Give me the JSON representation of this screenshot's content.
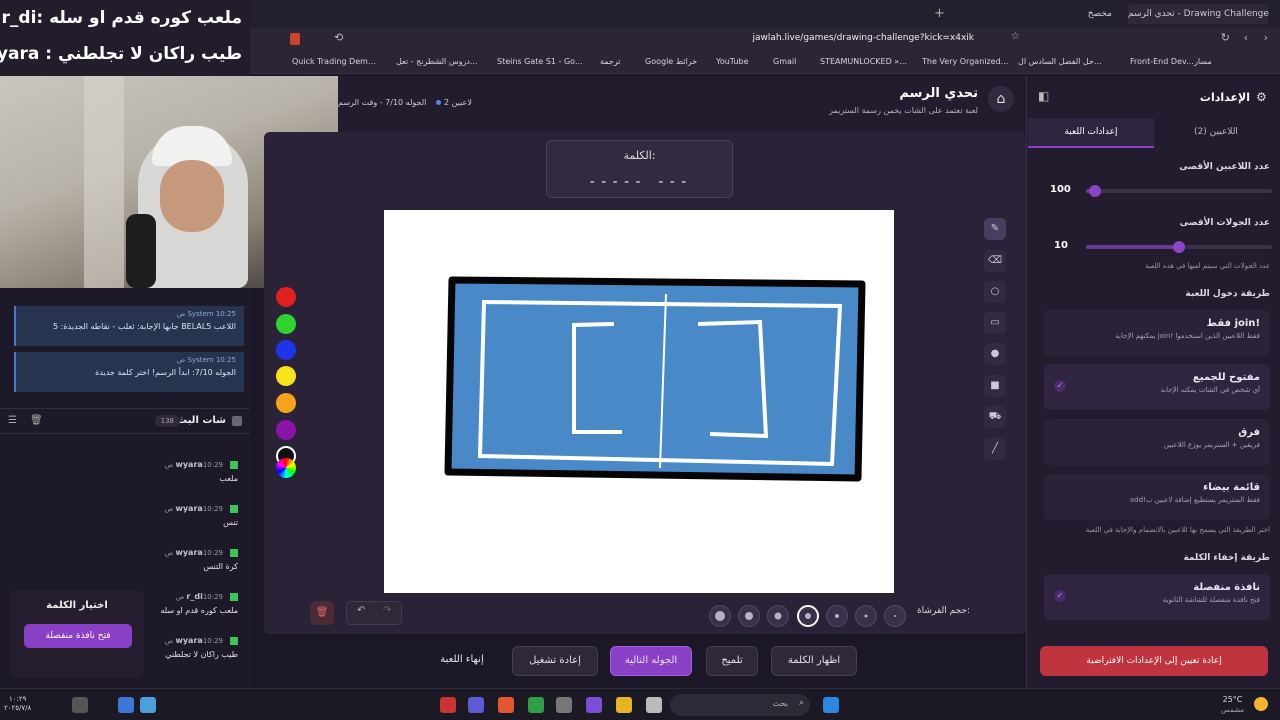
{
  "overlay": {
    "line1": "ملعب كوره قدم او سله :r_di",
    "line2": "طيب راكان لا تجلطني : wyara"
  },
  "browser": {
    "tab_title": "تحدي الرسم - Drawing Challenge",
    "tab2": "مخصخ",
    "url": "jawlah.live/games/drawing-challenge?kick=x4xik",
    "bookmarks": [
      "Quick Trading Dem...",
      "دروس الشطرنج - تعل...",
      "Steins Gate S1 - Go...",
      "ترجمة",
      "Google خرائط",
      "YouTube",
      "Gmail",
      "STEAMUNLOCKED »...",
      "The Very Organized...",
      "حل الفصل السادس ال...",
      "Front-End Dev...",
      "مسار"
    ]
  },
  "header": {
    "title": "تحدي الرسم",
    "subtitle": "لعبة تعتمد على الشات يخمن رسمة الستريمر",
    "players": "2 لاعبين",
    "round_info": "الجوله 7/10 - وقت الرسم"
  },
  "word": {
    "label": "الكلمة:",
    "mask": "----- ---"
  },
  "palette": {
    "colors": [
      "#e0201e",
      "#2fd22f",
      "#1c35e8",
      "#f8e21c",
      "#f5a41a",
      "#8a13a8",
      "#111111"
    ]
  },
  "tools": [
    "pencil-icon",
    "eraser-icon",
    "circle-icon",
    "rect-icon",
    "fill-circle-icon",
    "fill-rect-icon",
    "bucket-icon",
    "line-icon"
  ],
  "brush": {
    "label": "حجم الفرشاة:",
    "sizes": [
      1,
      2,
      3,
      5,
      7,
      9,
      11
    ],
    "selected_index": 3
  },
  "actions": {
    "show_word": "اظهار الكلمة",
    "hint": "تلميح",
    "next_round": "الجوله التالية",
    "restart": "إعادة تشغيل",
    "end_game": "إنهاء اللعبة"
  },
  "chat": {
    "title": "شات البث",
    "count": "138",
    "system_messages": [
      {
        "meta": "System 10:25 ص",
        "text": "اللاعب BELAL5 جابها الإجابة: ثعلب - نقاطه الجديدة: 5"
      },
      {
        "meta": "System 10:25 ص",
        "text": "الجوله 7/10: ابدأ الرسم! اختر كلمة جديدة"
      }
    ],
    "messages": [
      {
        "user": "wyara",
        "time": "10:29 ص",
        "text": "ملعب"
      },
      {
        "user": "wyara",
        "time": "10:29 ص",
        "text": "تنس"
      },
      {
        "user": "wyara",
        "time": "10:29 ص",
        "text": "كرة التنس"
      },
      {
        "user": "r_di",
        "time": "10:29 ص",
        "text": "ملعب كوره قدم او سله"
      },
      {
        "user": "wyara",
        "time": "10:29 ص",
        "text": "طيب راكان لا تجلطني"
      }
    ]
  },
  "pick_word": {
    "title": "اختيار الكلمة",
    "button": "فتح نافذة منفصلة"
  },
  "settings": {
    "title": "الإعدادات",
    "tabs": [
      "إعدادات اللعبة",
      "اللاعبين (2)"
    ],
    "max_players_label": "عدد اللاعبين الأقصى",
    "max_players_value": "100",
    "max_players_fraction": 0.05,
    "max_rounds_label": "عدد الجولات الأقصى",
    "max_rounds_value": "10",
    "max_rounds_fraction": 0.5,
    "max_rounds_hint": "عدد الجولات التي سيتم لعبها في هذه اللعبة",
    "join_method_label": "طريقة دخول اللعبة",
    "join_options": [
      {
        "title": "!join فقط",
        "desc": "فقط اللاعبين الذين استخدموا !join يمكنهم الإجابة",
        "selected": false
      },
      {
        "title": "مفتوح للجميع",
        "desc": "أي شخص في الشات يمكنه الإجابة",
        "selected": true
      },
      {
        "title": "فرق",
        "desc": "فريقين + الستريمر يوزع اللاعبين",
        "selected": false
      },
      {
        "title": "قائمة بيضاء",
        "desc": "فقط الستريمر يستطيع إضافة لاعبين ب!add",
        "selected": false
      }
    ],
    "join_hint": "اختر الطريقة التي يسمح بها للاعبين بالانضمام والإجابة في اللعبة",
    "hide_method_label": "طريقة إخفاء الكلمة",
    "hide_option": {
      "title": "نافذة منفصلة",
      "desc": "فتح نافذة منفصلة للشاشة الثانوية",
      "selected": true
    },
    "reset": "إعادة تعيين إلى الإعدادات الافتراضية"
  },
  "taskbar": {
    "search": "بحث",
    "weather_temp": "25°C",
    "weather_desc": "مشمس",
    "clock_time": "١٠:٢٩",
    "clock_date": "٢٠٢٥/٧/٨"
  }
}
